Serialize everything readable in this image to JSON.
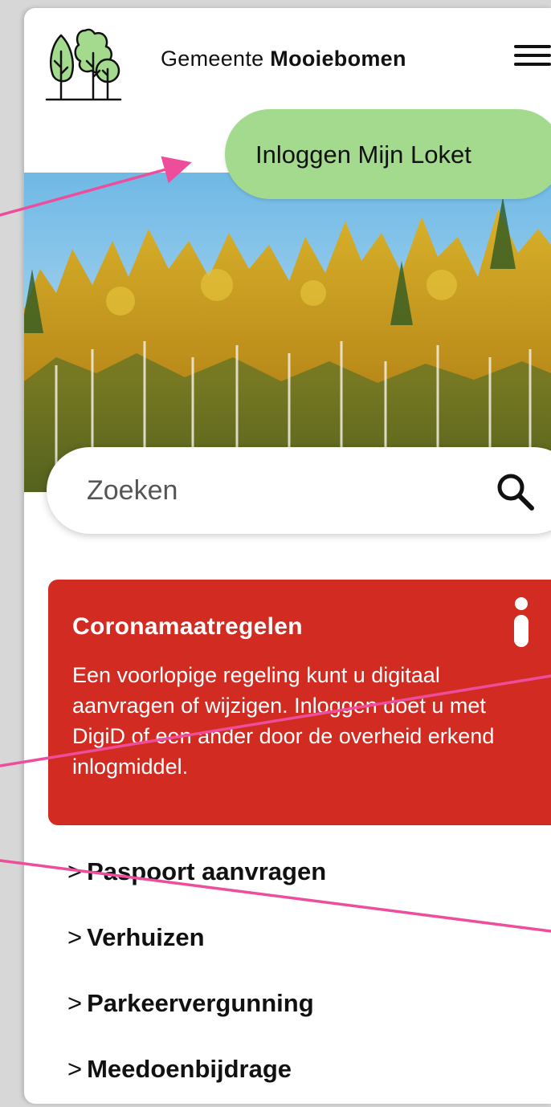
{
  "header": {
    "municipality_prefix": "Gemeente",
    "municipality_name": "Mooiebomen",
    "logo_icon": "tree-logo-icon",
    "menu_icon": "hamburger-menu-icon"
  },
  "login_button": {
    "label": "Inloggen Mijn Loket"
  },
  "hero": {
    "image": "autumn-forest-photo"
  },
  "search": {
    "placeholder": "Zoeken",
    "icon": "search-icon"
  },
  "alert": {
    "title": "Coronamaatregelen",
    "body": "Een voorlopige regeling kunt u digitaal aanvragen of wijzigen. Inloggen doet u met DigiD of een ander door de overheid erkend inlogmiddel.",
    "icon": "info-icon",
    "color": "#d12b22"
  },
  "links": [
    {
      "prefix": ">",
      "label": "Paspoort aanvragen"
    },
    {
      "prefix": ">",
      "label": "Verhuizen"
    },
    {
      "prefix": ">",
      "label": "Parkeervergunning"
    },
    {
      "prefix": ">",
      "label": "Meedoenbijdrage"
    }
  ],
  "colors": {
    "accent_green": "#a4da8d",
    "annotation_pink": "#ee4d9b"
  }
}
